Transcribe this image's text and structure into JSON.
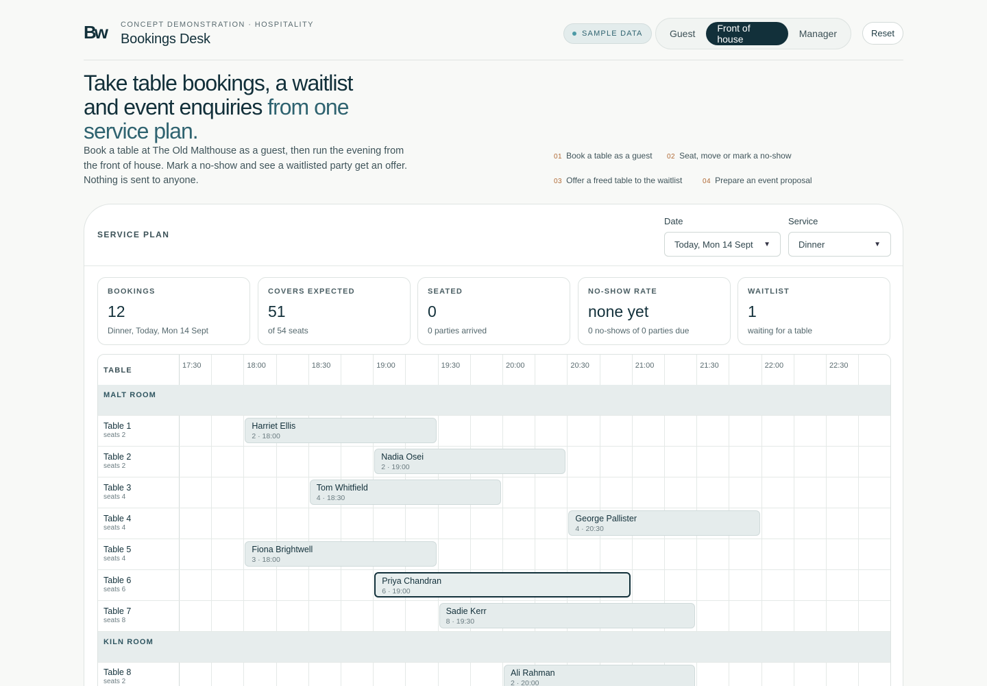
{
  "header": {
    "eyebrow": "CONCEPT DEMONSTRATION · HOSPITALITY",
    "title": "Bookings Desk",
    "sample_badge": "SAMPLE DATA",
    "views": [
      "Guest",
      "Front of house",
      "Manager"
    ],
    "active_view": "Front of house",
    "reset_label": "Reset"
  },
  "hero": {
    "title_main": "Take table bookings, a waitlist and event enquiries ",
    "title_accent": "from one service plan.",
    "subtitle": "Book a table at The Old Malthouse as a guest, then run the evening from the front of house. Mark a no-show and see a waitlisted party get an offer. Nothing is sent to anyone."
  },
  "steps": [
    {
      "num": "01",
      "label": "Book a table as a guest"
    },
    {
      "num": "02",
      "label": "Seat, move or mark a no-show"
    },
    {
      "num": "03",
      "label": "Offer a freed table to the waitlist"
    },
    {
      "num": "04",
      "label": "Prepare an event proposal"
    }
  ],
  "plan": {
    "label": "SERVICE PLAN",
    "date_label": "Date",
    "date_value": "Today, Mon 14 Sept",
    "service_label": "Service",
    "service_value": "Dinner"
  },
  "stats": [
    {
      "label": "BOOKINGS",
      "value": "12",
      "note": "Dinner, Today, Mon 14 Sept"
    },
    {
      "label": "COVERS EXPECTED",
      "value": "51",
      "note": "of 54 seats"
    },
    {
      "label": "SEATED",
      "value": "0",
      "note": "0 parties arrived"
    },
    {
      "label": "NO-SHOW RATE",
      "value": "none yet",
      "note": "0 no-shows of 0 parties due"
    },
    {
      "label": "WAITLIST",
      "value": "1",
      "note": "waiting for a table"
    }
  ],
  "grid": {
    "table_header": "TABLE",
    "times": [
      "17:30",
      "18:00",
      "18:30",
      "19:00",
      "19:30",
      "20:00",
      "20:30",
      "21:00",
      "21:30",
      "22:00",
      "22:30"
    ],
    "sections": [
      "MALT ROOM",
      "KILN ROOM"
    ],
    "tables": [
      {
        "name": "Table 1",
        "seats": "seats 2"
      },
      {
        "name": "Table 2",
        "seats": "seats 2"
      },
      {
        "name": "Table 3",
        "seats": "seats 4"
      },
      {
        "name": "Table 4",
        "seats": "seats 4"
      },
      {
        "name": "Table 5",
        "seats": "seats 4"
      },
      {
        "name": "Table 6",
        "seats": "seats 6"
      },
      {
        "name": "Table 7",
        "seats": "seats 8"
      },
      {
        "name": "Table 8",
        "seats": "seats 2"
      }
    ],
    "bookings": [
      {
        "table": 0,
        "name": "Harriet Ellis",
        "meta": "2 · 18:00",
        "start": "18:00",
        "end": "19:30",
        "selected": false
      },
      {
        "table": 1,
        "name": "Nadia Osei",
        "meta": "2 · 19:00",
        "start": "19:00",
        "end": "20:30",
        "selected": false
      },
      {
        "table": 2,
        "name": "Tom Whitfield",
        "meta": "4 · 18:30",
        "start": "18:30",
        "end": "20:00",
        "selected": false
      },
      {
        "table": 3,
        "name": "George Pallister",
        "meta": "4 · 20:30",
        "start": "20:30",
        "end": "22:00",
        "selected": false
      },
      {
        "table": 4,
        "name": "Fiona Brightwell",
        "meta": "3 · 18:00",
        "start": "18:00",
        "end": "19:30",
        "selected": false
      },
      {
        "table": 5,
        "name": "Priya Chandran",
        "meta": "6 · 19:00",
        "start": "19:00",
        "end": "21:00",
        "selected": true
      },
      {
        "table": 6,
        "name": "Sadie Kerr",
        "meta": "8 · 19:30",
        "start": "19:30",
        "end": "21:30",
        "selected": false
      },
      {
        "table": 7,
        "name": "Ali Rahman",
        "meta": "2 · 20:00",
        "start": "20:00",
        "end": "21:30",
        "selected": false
      }
    ]
  }
}
